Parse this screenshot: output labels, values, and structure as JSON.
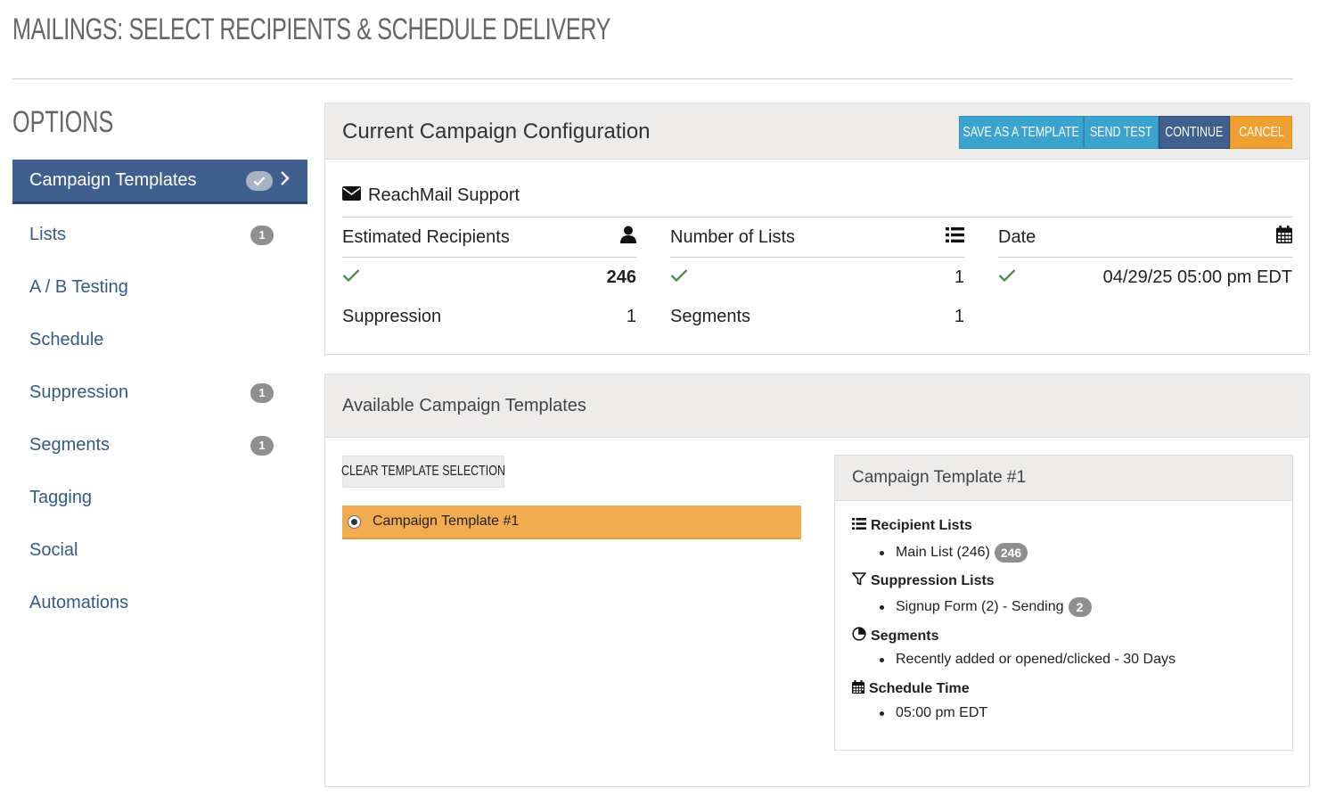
{
  "page": {
    "title": "MAILINGS: SELECT RECIPIENTS & SCHEDULE DELIVERY"
  },
  "sidebar": {
    "title": "OPTIONS",
    "items": [
      {
        "label": "Campaign Templates",
        "active": true
      },
      {
        "label": "Lists",
        "badge": "1"
      },
      {
        "label": "A / B Testing"
      },
      {
        "label": "Schedule"
      },
      {
        "label": "Suppression",
        "badge": "1"
      },
      {
        "label": "Segments",
        "badge": "1"
      },
      {
        "label": "Tagging"
      },
      {
        "label": "Social"
      },
      {
        "label": "Automations"
      }
    ]
  },
  "config": {
    "title": "Current Campaign Configuration",
    "buttons": {
      "save_template": "SAVE AS A TEMPLATE",
      "send_test": "SEND TEST",
      "continue": "CONTINUE",
      "cancel": "CANCEL"
    },
    "account": "ReachMail Support",
    "recipients": {
      "header": "Estimated Recipients",
      "value": "246",
      "suppression_label": "Suppression",
      "suppression_value": "1"
    },
    "lists": {
      "header": "Number of Lists",
      "value": "1",
      "segments_label": "Segments",
      "segments_value": "1"
    },
    "date": {
      "header": "Date",
      "value": "04/29/25 05:00 pm EDT"
    }
  },
  "templates": {
    "title": "Available Campaign Templates",
    "clear_button": "CLEAR TEMPLATE SELECTION",
    "selected": "Campaign Template #1",
    "detail": {
      "title": "Campaign Template #1",
      "recipient_lists_label": "Recipient Lists",
      "recipient_list_item": "Main List (246)",
      "recipient_list_count": "246",
      "suppression_lists_label": "Suppression Lists",
      "suppression_item": "Signup Form (2) - Sending",
      "suppression_count": "2",
      "segments_label": "Segments",
      "segment_item": "Recently added or opened/clicked - 30 Days",
      "schedule_label": "Schedule Time",
      "schedule_item": "05:00 pm EDT"
    }
  },
  "colors": {
    "primary": "#3f5f8f",
    "info": "#3aa3cf",
    "warning": "#f0a030",
    "link": "#345a8a",
    "success": "#3a8a3a"
  }
}
